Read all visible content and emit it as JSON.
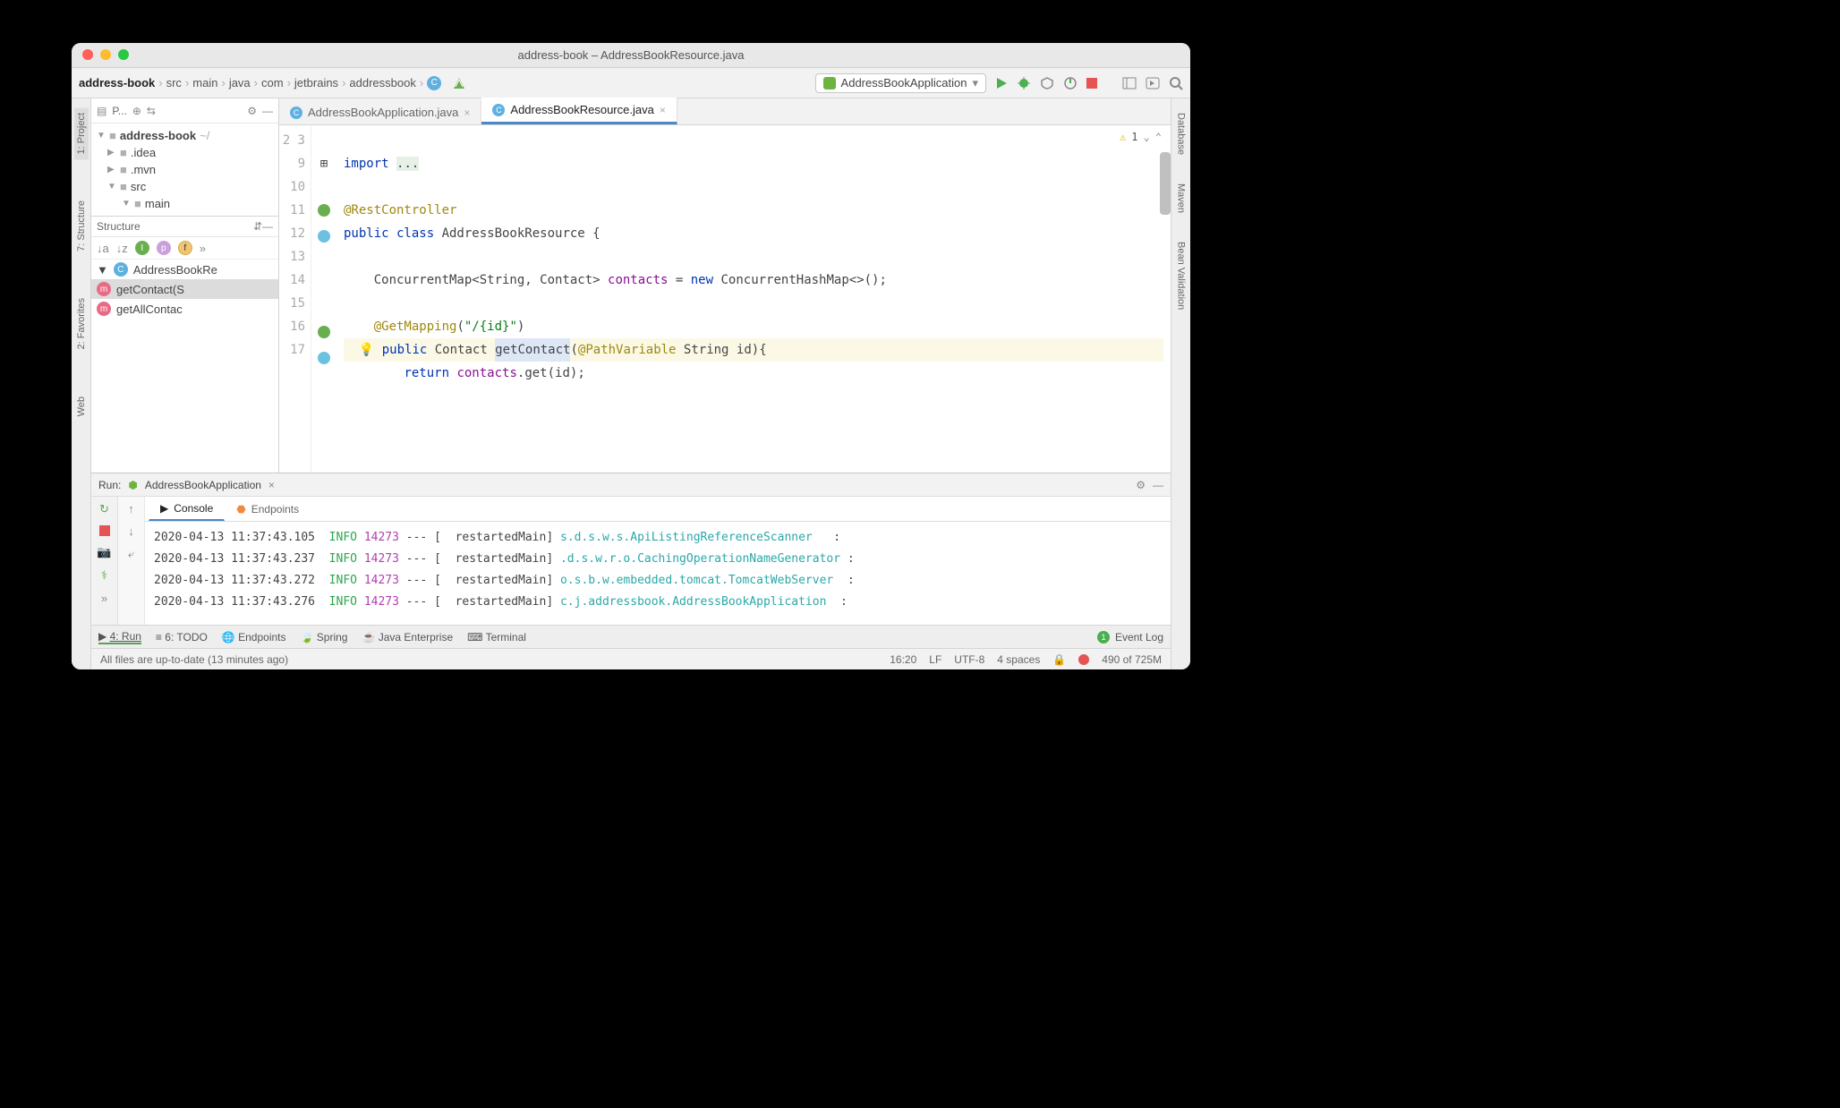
{
  "window_title": "address-book – AddressBookResource.java",
  "breadcrumbs": [
    "address-book",
    "src",
    "main",
    "java",
    "com",
    "jetbrains",
    "addressbook"
  ],
  "breadcrumb_tail_icon": "C",
  "run_config": "AddressBookApplication",
  "left_tabs": [
    "1: Project",
    "7: Structure",
    "2: Favorites",
    "Web"
  ],
  "right_tabs": [
    "Database",
    "Maven",
    "Bean Validation"
  ],
  "project_panel": {
    "label": "P..."
  },
  "tree": {
    "root": "address-book",
    "root_suffix": " ~/",
    "nodes": [
      ".idea",
      ".mvn",
      "src",
      "main"
    ]
  },
  "structure": {
    "label": "Structure",
    "class": "AddressBookRe",
    "members": [
      "getContact(S",
      "getAllContac"
    ]
  },
  "editor_tabs": [
    {
      "name": "AddressBookApplication.java",
      "active": false
    },
    {
      "name": "AddressBookResource.java",
      "active": true
    }
  ],
  "inspection": {
    "warn_count": "1"
  },
  "code_lines": {
    "start": 2,
    "lines": [
      "",
      "import ...",
      "",
      "@RestController",
      "public class AddressBookResource {",
      "",
      "    ConcurrentMap<String, Contact> contacts = new ConcurrentHashMap<>();",
      "",
      "    @GetMapping(\"/{id}\")",
      "    public Contact getContact(@PathVariable String id){",
      "        return contacts.get(id);"
    ]
  },
  "run": {
    "label": "Run:",
    "name": "AddressBookApplication",
    "tabs": [
      "Console",
      "Endpoints"
    ],
    "log": [
      {
        "ts": "2020-04-13 11:37:43.105",
        "lvl": "INFO",
        "pid": "14273",
        "thr": "restartedMain",
        "src": "s.d.s.w.s.ApiListingReferenceScanner"
      },
      {
        "ts": "2020-04-13 11:37:43.237",
        "lvl": "INFO",
        "pid": "14273",
        "thr": "restartedMain",
        "src": ".d.s.w.r.o.CachingOperationNameGenerator"
      },
      {
        "ts": "2020-04-13 11:37:43.272",
        "lvl": "INFO",
        "pid": "14273",
        "thr": "restartedMain",
        "src": "o.s.b.w.embedded.tomcat.TomcatWebServer"
      },
      {
        "ts": "2020-04-13 11:37:43.276",
        "lvl": "INFO",
        "pid": "14273",
        "thr": "restartedMain",
        "src": "c.j.addressbook.AddressBookApplication"
      }
    ]
  },
  "bottom_tabs": [
    "4: Run",
    "6: TODO",
    "Endpoints",
    "Spring",
    "Java Enterprise",
    "Terminal"
  ],
  "event_log": "Event Log",
  "status": {
    "left": "All files are up-to-date (13 minutes ago)",
    "pos": "16:20",
    "sep": "LF",
    "enc": "UTF-8",
    "indent": "4 spaces",
    "mem": "490 of 725M"
  }
}
